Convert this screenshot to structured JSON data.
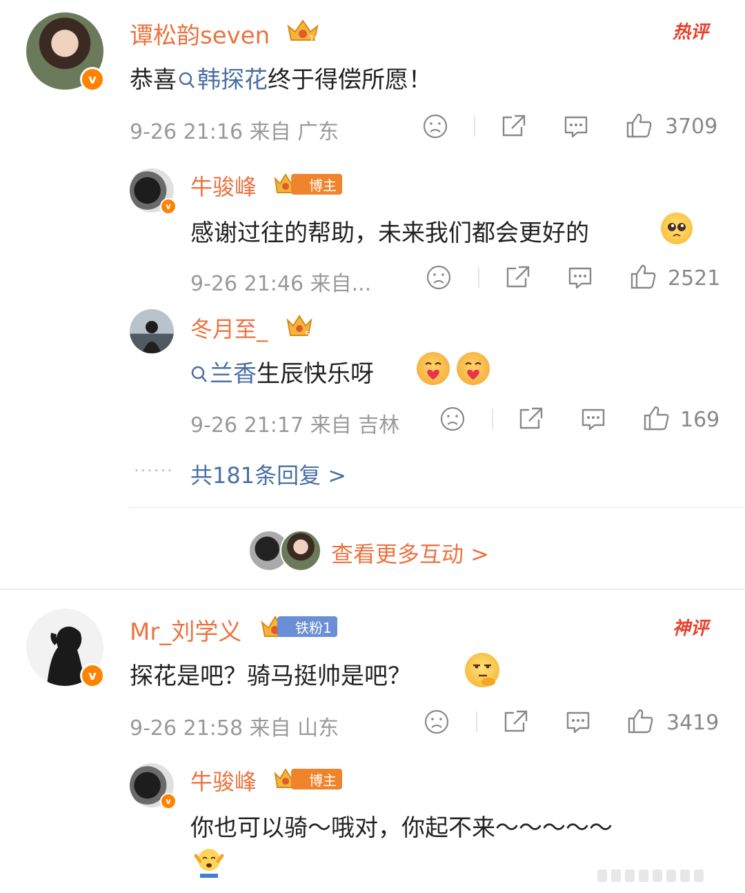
{
  "colors": {
    "brand": "#ff8200",
    "name": "#eb7340",
    "link": "#4a6fa5",
    "meta": "#999999"
  },
  "comment1": {
    "username": "谭松韵seven",
    "tag": "热评",
    "text_prefix": "恭喜",
    "text_link": "韩探花",
    "text_suffix": "终于得偿所愿！",
    "meta": "9-26 21:16 来自 广东",
    "likes": "3709",
    "reply1": {
      "username": "牛骏峰",
      "badge": "博主",
      "text": "感谢过往的帮助，未来我们都会更好的",
      "meta": "9-26 21:46 来自...",
      "likes": "2521"
    },
    "reply2": {
      "username": "冬月至_",
      "text_link": "兰香",
      "text_suffix": "生辰快乐呀",
      "meta": "9-26 21:17 来自 吉林",
      "likes": "169"
    },
    "more_replies": "共181条回复 >",
    "more_interactions": "查看更多互动 >"
  },
  "comment2": {
    "username": "Mr_刘学义",
    "badge": "铁粉1",
    "tag": "神评",
    "text": "探花是吧？骑马挺帅是吧？",
    "meta": "9-26 21:58 来自 山东",
    "likes": "3419",
    "reply1": {
      "username": "牛骏峰",
      "badge": "博主",
      "text": "你也可以骑～哦对，你起不来～～～～～"
    }
  },
  "icons": [
    "dislike-icon",
    "share-icon",
    "comment-icon",
    "like-icon",
    "search-icon",
    "crown-icon",
    "verified-icon"
  ]
}
